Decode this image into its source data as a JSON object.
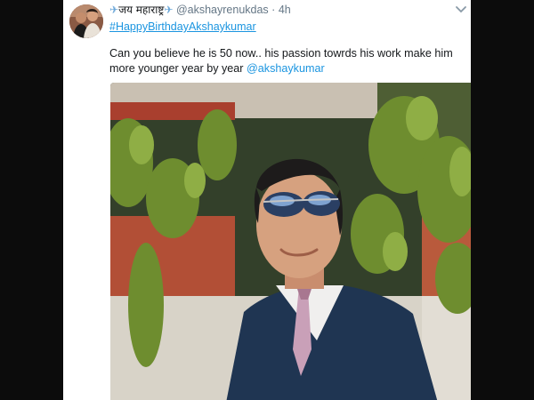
{
  "tweet": {
    "display_name": "जय महाराष्ट्र",
    "name_prefix_icon": "airplane-icon",
    "name_suffix_icon": "airplane-icon",
    "handle": "@akshayrenukdas",
    "separator": "·",
    "time": "4h",
    "hashtag": "#HappyBirthdayAkshaykumar",
    "text": "Can you believe he is 50 now.. his passion towrds his work make him more younger year by year ",
    "mention": "@akshaykumar",
    "menu_icon": "chevron-down-icon",
    "photo_alt": "Man in sunglasses and dark blue suit in front of foliage"
  },
  "colors": {
    "link": "#1b95e0",
    "muted": "#657786",
    "text": "#14171a",
    "background": "#0c0c0c"
  }
}
